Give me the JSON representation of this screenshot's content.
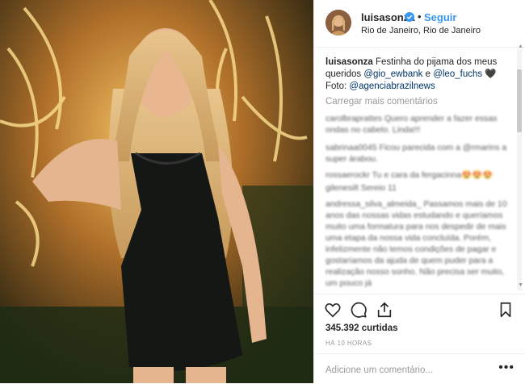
{
  "header": {
    "username": "luisasonza",
    "separator": "•",
    "follow_label": "Seguir",
    "location": "Rio de Janeiro, Rio de Janeiro"
  },
  "caption": {
    "username": "luisasonza",
    "text_1": "Festinha do pijama dos meus queridos",
    "mention_1": "@gio_ewbank",
    "conj": "e",
    "mention_2": "@leo_fuchs",
    "heart": "🖤",
    "photo_label": "Foto:",
    "mention_3": "@agenciabrazilnews"
  },
  "load_more_label": "Carregar mais comentários",
  "comments": [
    "carolbraprattes Quero aprender a fazer essas ondas no cabelo. Linda!!!",
    "sabrinaa0045 Ficou parecida com a @rmarins a super árabou.",
    "rossaerockr Tu e cara da fergacinna😍😍😍",
    "gilenesilt Sereio 11",
    "andressa_silva_almeida_ Passamos mais de 10 anos das nossas vidas estudando e queríamos muito uma formatura para nos despedir de mais uma etapa da nossa vida concluída. Porém, infelizmente não temos condições de pagar e gostaríamos da ajuda de quem puder para a realização nosso sonho. Não precisa ser muito, um pouco já"
  ],
  "likes_label": "345.392 curtidas",
  "time_label": "HÁ 10 HORAS",
  "add_comment_placeholder": "Adicione um comentário...",
  "more_label": "•••",
  "colors": {
    "link": "#3897f0",
    "mention": "#003569",
    "muted": "#999999",
    "verified": "#3897f0"
  }
}
